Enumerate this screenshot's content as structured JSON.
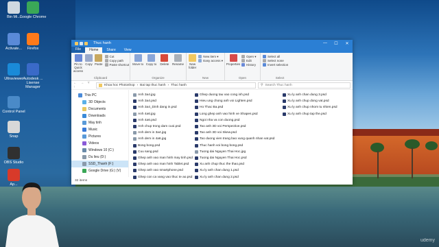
{
  "desktop_icons": [
    {
      "label": "Bin Mi...",
      "color": "#cfd8e0"
    },
    {
      "label": "Google Chrome",
      "color": "#3aa757"
    },
    {
      "label": "Activate...",
      "color": "#5a8ad8"
    },
    {
      "label": "Firefox",
      "color": "#ff7a1a"
    },
    {
      "label": "Ultraviewer",
      "color": "#1a8ad8"
    },
    {
      "label": "Autodesk ... Lisense Manager",
      "color": "#3a6ac8"
    },
    {
      "label": "Control Panel",
      "color": "#4a8ac8"
    },
    {
      "label": "Snap",
      "color": "#d8d8d8"
    },
    {
      "label": "OBS Studio",
      "color": "#303030"
    },
    {
      "label": "Ap...",
      "color": "#d83a2a"
    }
  ],
  "window": {
    "title": "Thuc hanh",
    "tabs": [
      "File",
      "Home",
      "Share",
      "View"
    ],
    "active_tab": "Home",
    "controls": [
      "—",
      "☐",
      "✕"
    ]
  },
  "ribbon": {
    "clipboard": {
      "label": "Clipboard",
      "buttons": [
        "Pin to Quick access",
        "Copy",
        "Paste"
      ],
      "small": [
        "Cut",
        "Copy path",
        "Paste shortcut"
      ]
    },
    "organize": {
      "label": "Organize",
      "buttons": [
        "Move to",
        "Copy to",
        "Delete",
        "Rename"
      ]
    },
    "new": {
      "label": "New",
      "buttons": [
        "New folder"
      ],
      "small": [
        "New item ▾",
        "Easy access ▾"
      ]
    },
    "open": {
      "label": "Open",
      "buttons": [
        "Properties"
      ],
      "small": [
        "Open ▾",
        "Edit",
        "History"
      ]
    },
    "select": {
      "label": "Select",
      "small": [
        "Select all",
        "Select none",
        "Invert selection"
      ]
    }
  },
  "address": {
    "nav": "← → ˅ ↑",
    "path": [
      "Khoa hoc Photoshop",
      "Bai tap thuc hanh",
      "Thuc hanh"
    ],
    "search_placeholder": "Search Thuc hanh"
  },
  "nav_pane": [
    {
      "label": "This PC",
      "color": "#4a8ad8",
      "sub": false,
      "selected": false
    },
    {
      "label": "3D Objects",
      "color": "#5ab0e8",
      "sub": true,
      "selected": false
    },
    {
      "label": "Documents",
      "color": "#e8c860",
      "sub": true,
      "selected": false
    },
    {
      "label": "Downloads",
      "color": "#3a8ad8",
      "sub": true,
      "selected": false
    },
    {
      "label": "May tinh",
      "color": "#5a9ad8",
      "sub": true,
      "selected": false
    },
    {
      "label": "Music",
      "color": "#3a7ad8",
      "sub": true,
      "selected": false
    },
    {
      "label": "Pictures",
      "color": "#5a9ad8",
      "sub": true,
      "selected": false
    },
    {
      "label": "Videos",
      "color": "#8a5ad8",
      "sub": true,
      "selected": false
    },
    {
      "label": "Windows 10 (C:)",
      "color": "#6a8aa8",
      "sub": true,
      "selected": false
    },
    {
      "label": "Du lieu (D:)",
      "color": "#8a9aaa",
      "sub": true,
      "selected": false
    },
    {
      "label": "SSD_Thanh (F:)",
      "color": "#8a9aaa",
      "sub": true,
      "selected": true
    },
    {
      "label": "Google Drive (G:) (V)",
      "color": "#3aa757",
      "sub": true,
      "selected": false
    }
  ],
  "files": [
    [
      {
        "name": "Anh 3a4.jpg",
        "type": "jpg"
      },
      {
        "name": "Anh 3a4.psd",
        "type": "psd"
      },
      {
        "name": "Anh 3a4_Dinh dang in.psd",
        "type": "psd"
      },
      {
        "name": "Anh 4a6.jpg",
        "type": "jpg"
      },
      {
        "name": "Anh 4a6.psd",
        "type": "psd"
      },
      {
        "name": "Anh chup trong dam cuoi.psd",
        "type": "psd"
      },
      {
        "name": "Anh dem in 3a4.jpg",
        "type": "jpg"
      },
      {
        "name": "Anh dem in 4a6.jpg",
        "type": "jpg"
      },
      {
        "name": "Bong bong.psd",
        "type": "psd"
      },
      {
        "name": "Cuu sang.psd",
        "type": "psd"
      },
      {
        "name": "Ghep anh vao man hinh may tinh.psd",
        "type": "psd"
      },
      {
        "name": "Ghep anh vao man hinh Tablet.psd",
        "type": "psd"
      },
      {
        "name": "Ghep anh vao smartphone.psd",
        "type": "psd"
      },
      {
        "name": "Ghep con ca vang vao thuc te ao.psd",
        "type": "psd"
      }
    ],
    [
      {
        "name": "Ghep duong tau vao cong inh.psd",
        "type": "psd"
      },
      {
        "name": "Hieu ung chong anh voi Lighten.psd",
        "type": "psd"
      },
      {
        "name": "Ho Thac Ba.psd",
        "type": "psd"
      },
      {
        "name": "Long ghep anh vao hinh ve Shapes.psd",
        "type": "psd"
      },
      {
        "name": "Ngoi nha va con duong.psd",
        "type": "psd"
      },
      {
        "name": "Tao anh 3D voi Perspective.psd",
        "type": "psd"
      },
      {
        "name": "Tao anh 3D voi Skew.psd",
        "type": "psd"
      },
      {
        "name": "Tao duong vien trang bao xung quanh nhan vat.psd",
        "type": "psd"
      },
      {
        "name": "Thuc hanh voi bong bong.psd",
        "type": "psd"
      },
      {
        "name": "Tuong dai Nguyen Thai Hoc.jpg",
        "type": "jpg"
      },
      {
        "name": "Tuong dai Nguyen Thai Hoc.psd",
        "type": "psd"
      },
      {
        "name": "Xu anh chup thuc the thao.psd",
        "type": "psd"
      },
      {
        "name": "Xu ly anh chan dung 1.psd",
        "type": "psd"
      },
      {
        "name": "Xu ly anh chan dung 2.psd",
        "type": "psd"
      }
    ],
    [
      {
        "name": "Xu ly anh chan dung 3.psd",
        "type": "psd"
      },
      {
        "name": "Xu ly anh chup dong vat.psd",
        "type": "psd"
      },
      {
        "name": "Xu ly anh chup nhom tu nhien.psd",
        "type": "psd"
      },
      {
        "name": "Xu ly anh chup tap the.psd",
        "type": "psd"
      }
    ]
  ],
  "status": "32 items",
  "watermark": "udemy"
}
